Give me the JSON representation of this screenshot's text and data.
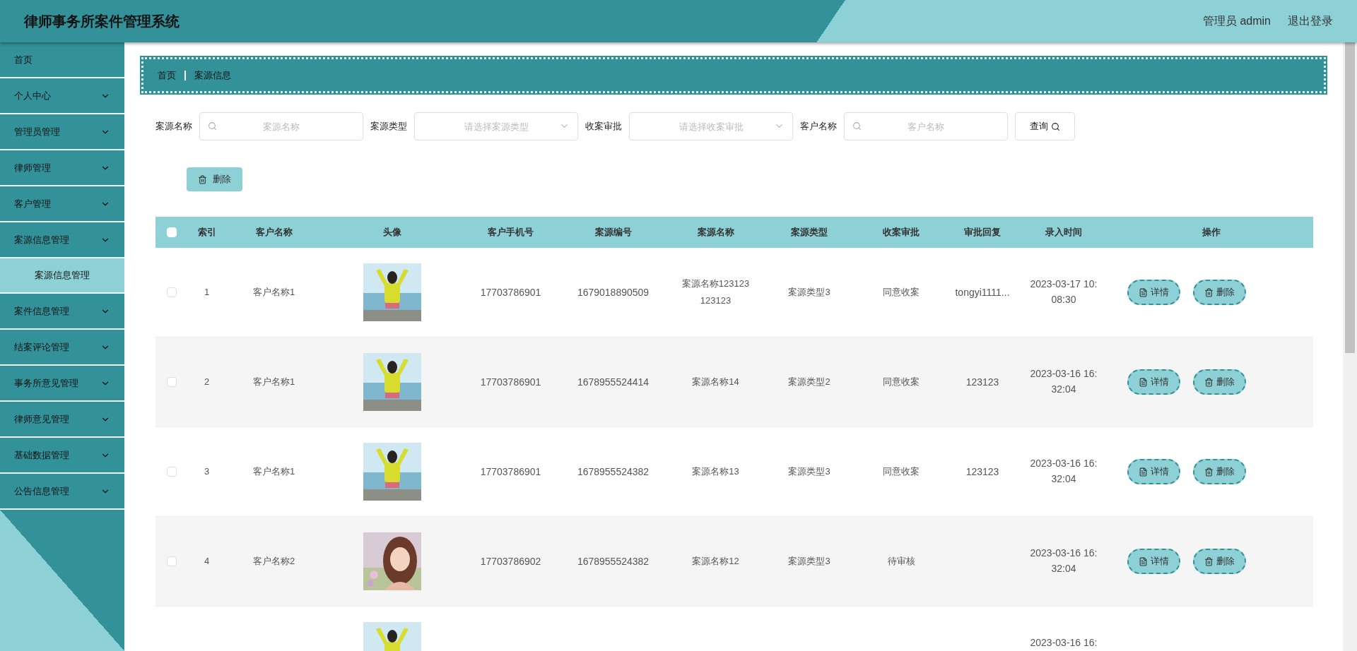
{
  "header": {
    "title": "律师事务所案件管理系统",
    "user": "管理员 admin",
    "logout": "退出登录"
  },
  "sidebar": {
    "items": [
      {
        "label": "首页",
        "kind": "link"
      },
      {
        "label": "个人中心",
        "kind": "menu"
      },
      {
        "label": "管理员管理",
        "kind": "menu"
      },
      {
        "label": "律师管理",
        "kind": "menu"
      },
      {
        "label": "客户管理",
        "kind": "menu"
      },
      {
        "label": "案源信息管理",
        "kind": "menu",
        "expanded": true,
        "children": [
          {
            "label": "案源信息管理",
            "selected": true
          }
        ]
      },
      {
        "label": "案件信息管理",
        "kind": "menu"
      },
      {
        "label": "结案评论管理",
        "kind": "menu"
      },
      {
        "label": "事务所意见管理",
        "kind": "menu"
      },
      {
        "label": "律师意见管理",
        "kind": "menu"
      },
      {
        "label": "基础数据管理",
        "kind": "menu"
      },
      {
        "label": "公告信息管理",
        "kind": "menu"
      }
    ]
  },
  "breadcrumb": [
    "首页",
    "案源信息"
  ],
  "search": {
    "fields": [
      {
        "label": "案源名称",
        "kind": "text",
        "placeholder": "案源名称"
      },
      {
        "label": "案源类型",
        "kind": "select",
        "placeholder": "请选择案源类型"
      },
      {
        "label": "收案审批",
        "kind": "select",
        "placeholder": "请选择收案审批"
      },
      {
        "label": "客户名称",
        "kind": "text",
        "placeholder": "客户名称"
      }
    ],
    "button": "查询"
  },
  "delete_button": "删除",
  "table": {
    "header_checked": false,
    "columns": [
      "索引",
      "客户名称",
      "头像",
      "客户手机号",
      "案源编号",
      "案源名称",
      "案源类型",
      "收案审批",
      "审批回复",
      "录入时间",
      "操作"
    ],
    "rows": [
      {
        "checked": false,
        "index": "1",
        "customer": "客户名称1",
        "photo": {
          "kind": "picture"
        },
        "phone": "17703786901",
        "number": "1679018890509",
        "name": "案源名称123123123123",
        "type": "案源类型3",
        "approval": "同意收案",
        "reply": "tongyi1111...",
        "time": [
          "2023-03-17 10:",
          "08:30"
        ],
        "actions": [
          "详情",
          "删除"
        ]
      },
      {
        "checked": false,
        "index": "2",
        "customer": "客户名称1",
        "photo": {
          "kind": "picture"
        },
        "phone": "17703786901",
        "number": "1678955524414",
        "name": "案源名称14",
        "type": "案源类型2",
        "approval": "同意收案",
        "reply": "123123",
        "time": [
          "2023-03-16 16:",
          "32:04"
        ],
        "actions": [
          "详情",
          "删除"
        ]
      },
      {
        "checked": false,
        "index": "3",
        "customer": "客户名称1",
        "photo": {
          "kind": "picture"
        },
        "phone": "17703786901",
        "number": "1678955524382",
        "name": "案源名称13",
        "type": "案源类型3",
        "approval": "同意收案",
        "reply": "123123",
        "time": [
          "2023-03-16 16:",
          "32:04"
        ],
        "actions": [
          "详情",
          "删除"
        ]
      },
      {
        "checked": false,
        "index": "4",
        "customer": "客户名称2",
        "photo": {
          "kind": "picture"
        },
        "phone": "17703786902",
        "number": "1678955524382",
        "name": "案源名称12",
        "type": "案源类型3",
        "approval": "待审核",
        "time": [
          "2023-03-16 16:",
          "32:04"
        ],
        "actions": [
          "详情",
          "删除"
        ]
      },
      {
        "photo": {
          "kind": "picture"
        },
        "time": [
          "2023-03-16 16:"
        ]
      }
    ]
  }
}
